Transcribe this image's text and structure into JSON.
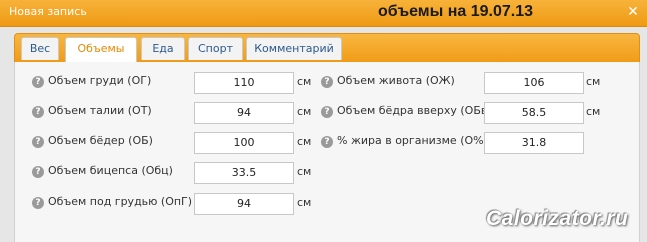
{
  "dialog": {
    "title": "Новая запись",
    "heading": "объемы на 19.07.13",
    "close_label": "✕"
  },
  "tabs": [
    {
      "label": "Вес",
      "active": false
    },
    {
      "label": "Объемы",
      "active": true
    },
    {
      "label": "Еда",
      "active": false
    },
    {
      "label": "Спорт",
      "active": false
    },
    {
      "label": "Комментарий",
      "active": false
    }
  ],
  "help_glyph": "?",
  "fields_left": [
    {
      "label": "Объем груди (ОГ)",
      "value": "110",
      "unit": "см"
    },
    {
      "label": "Объем талии (ОТ)",
      "value": "94",
      "unit": "см"
    },
    {
      "label": "Объем бёдер (ОБ)",
      "value": "100",
      "unit": "см"
    },
    {
      "label": "Объем бицепса (Обц)",
      "value": "33.5",
      "unit": "см"
    },
    {
      "label": "Объем под грудью (ОпГ)",
      "value": "94",
      "unit": "см"
    }
  ],
  "fields_right": [
    {
      "label": "Объем живота (ОЖ)",
      "value": "106",
      "unit": "см"
    },
    {
      "label": "Объем бёдра вверху (ОБв)",
      "value": "58.5",
      "unit": "см"
    },
    {
      "label": "% жира в организме (О%)",
      "value": "31.8",
      "unit": ""
    }
  ],
  "watermark": "Calorizator.ru",
  "colors": {
    "title_bar": "#f19c18",
    "active_tab_text": "#e58a00",
    "tab_text": "#2c5a8c"
  }
}
